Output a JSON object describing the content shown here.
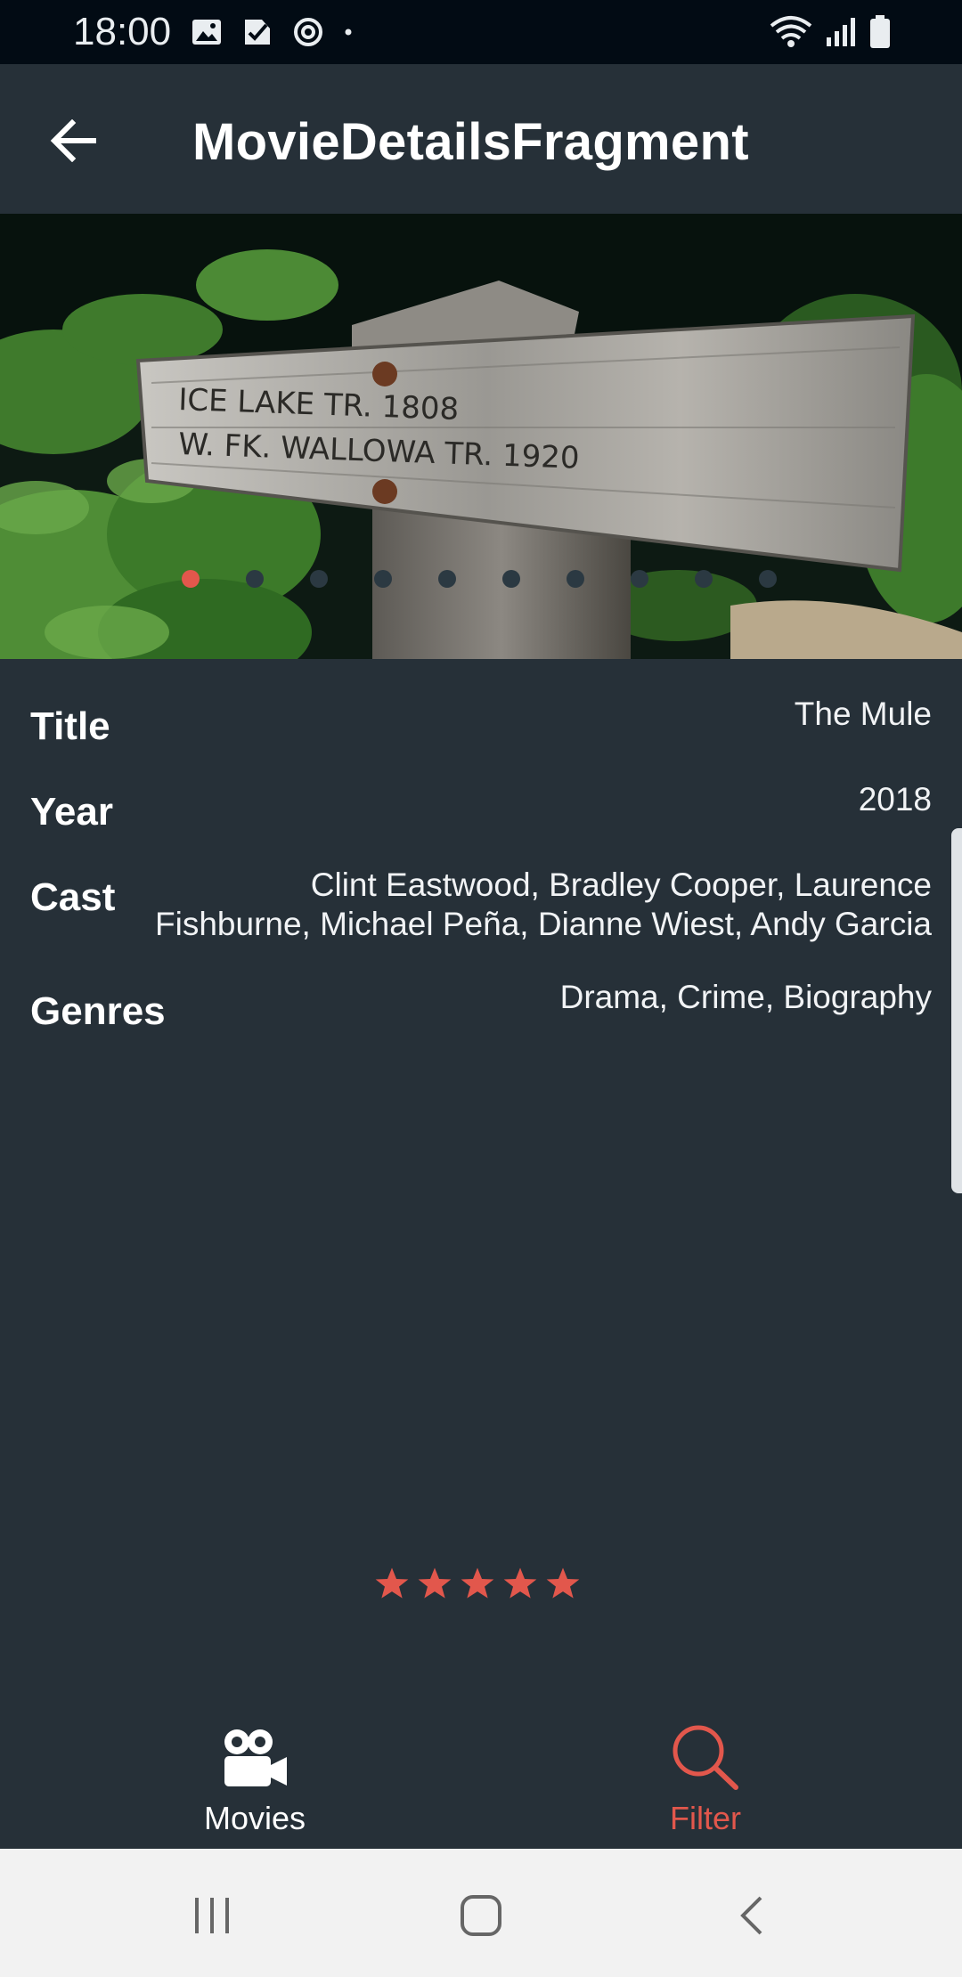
{
  "status_bar": {
    "time": "18:00",
    "left_icons": [
      "image-icon",
      "check-icon",
      "sync-icon",
      "dot-icon"
    ],
    "right_icons": [
      "wifi-icon",
      "signal-icon",
      "battery-icon"
    ]
  },
  "app_bar": {
    "title": "MovieDetailsFragment",
    "back_icon": "arrow-left-icon"
  },
  "carousel": {
    "image": "trail-sign-photo",
    "sign_lines": [
      "ICE LAKE TR. 1808",
      "W. FK. WALLOWA TR. 1920"
    ],
    "page_count": 10,
    "active_index": 0
  },
  "details": {
    "title_label": "Title",
    "title_value": "The Mule",
    "year_label": "Year",
    "year_value": "2018",
    "cast_label": "Cast",
    "cast_value": "Clint Eastwood, Bradley Cooper, Laurence Fishburne, Michael Peña, Dianne Wiest, Andy Garcia",
    "genres_label": "Genres",
    "genres_value": "Drama, Crime, Biography"
  },
  "rating": {
    "stars": 5,
    "max": 5
  },
  "bottom_nav": {
    "items": [
      {
        "label": "Movies",
        "icon": "movie-camera-icon",
        "active": false
      },
      {
        "label": "Filter",
        "icon": "search-icon",
        "active": true
      }
    ]
  },
  "colors": {
    "background": "#263038",
    "status_bar": "#020b14",
    "accent": "#e2574c",
    "system_nav": "#f2f2f2"
  }
}
